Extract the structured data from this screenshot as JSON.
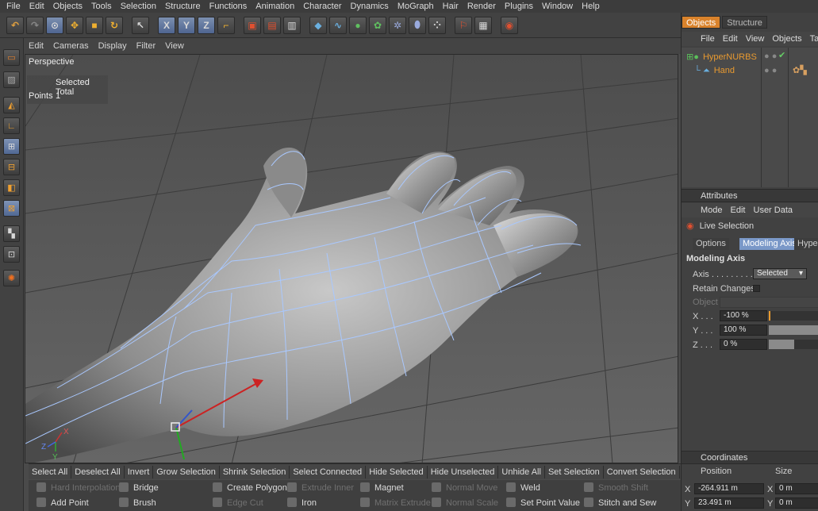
{
  "menubar": [
    "File",
    "Edit",
    "Objects",
    "Tools",
    "Selection",
    "Structure",
    "Functions",
    "Animation",
    "Character",
    "Dynamics",
    "MoGraph",
    "Hair",
    "Render",
    "Plugins",
    "Window",
    "Help"
  ],
  "viewport": {
    "menu": [
      "Edit",
      "Cameras",
      "Display",
      "Filter",
      "View"
    ],
    "label": "Perspective",
    "hud": {
      "header": "Selected Total",
      "row_label": "Points",
      "row_value": "1"
    },
    "axes": {
      "x": "X",
      "y": "Y",
      "z": "Z"
    }
  },
  "command_bar": [
    "Select All",
    "Deselect All",
    "Invert",
    "Grow Selection",
    "Shrink Selection",
    "Select Connected",
    "Hide Selected",
    "Hide Unselected",
    "Unhide All",
    "Set Selection",
    "Convert Selection"
  ],
  "command_grid": {
    "row1": [
      "Hard Interpolation",
      "Bridge",
      "Create Polygon",
      "Extrude Inner",
      "Magnet",
      "Normal Move",
      "Weld",
      "Smooth Shift"
    ],
    "row2": [
      "Add Point",
      "Brush",
      "Edge Cut",
      "Iron",
      "Matrix Extrude",
      "Normal Scale",
      "Set Point Value",
      "Stitch and Sew"
    ]
  },
  "right_panel": {
    "tabs": [
      "Objects",
      "Structure"
    ],
    "menu": [
      "File",
      "Edit",
      "View",
      "Objects",
      "Ta"
    ],
    "objects": [
      {
        "name": "HyperNURBS"
      },
      {
        "name": "Hand"
      }
    ],
    "attributes": {
      "header": "Attributes",
      "menu": [
        "Mode",
        "Edit",
        "User Data"
      ],
      "tool_name": "Live Selection",
      "subtabs": [
        "Options",
        "Modeling Axis",
        "HyperN"
      ],
      "section": "Modeling Axis",
      "axis_label": "Axis . . . . . . . . .",
      "axis_value": "Selected",
      "retain_label": "Retain Changes",
      "object_label": "Object",
      "x_label": "X . . .",
      "x_value": "-100 %",
      "x_level": 0,
      "y_label": "Y . . .",
      "y_value": "100 %",
      "y_level": 1,
      "z_label": "Z . . .",
      "z_value": "0 %",
      "z_level": 0.5
    },
    "coordinates": {
      "header": "Coordinates",
      "col_position": "Position",
      "col_size": "Size",
      "x_label": "X",
      "x_pos": "-264.911 m",
      "x_size": "0 m",
      "y_label": "Y",
      "y_pos": "23.491 m",
      "y_size": "0 m"
    }
  },
  "colors": {
    "accent": "#d9822b",
    "selection_blue": "#7a98c8",
    "wireframe": "#a9c8ff",
    "viewport_bg": "#595959"
  }
}
